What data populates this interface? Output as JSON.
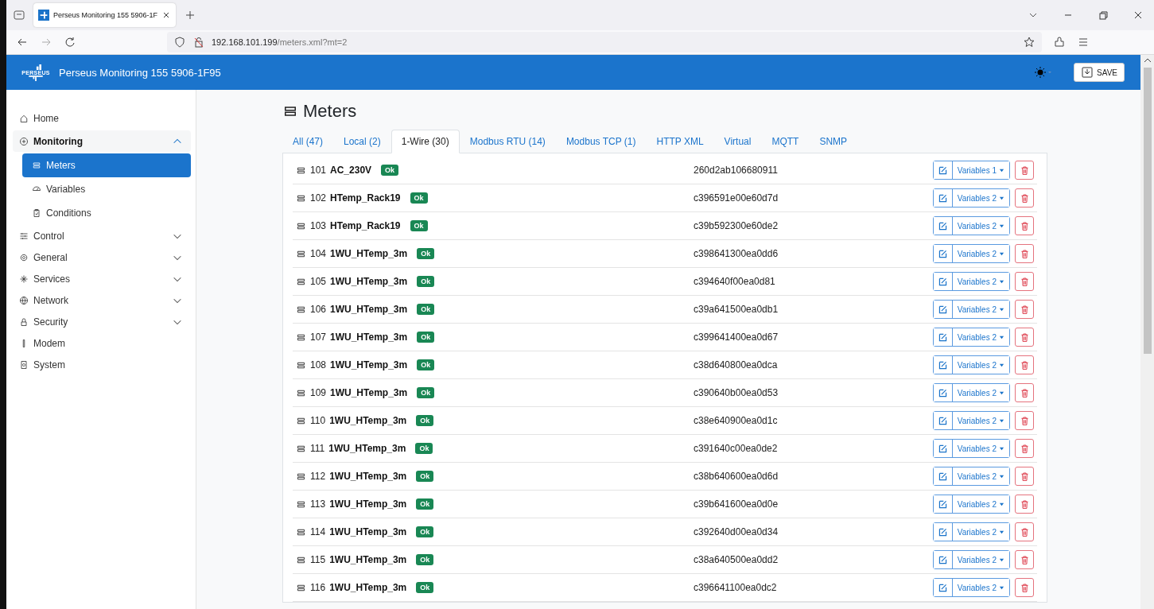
{
  "browser": {
    "tab_title": "Perseus Monitoring 155 5906-1F",
    "url_host": "192.168.101.199",
    "url_path": "/meters.xml?mt=2"
  },
  "header": {
    "logo_text": "PERSEUS",
    "title": "Perseus Monitoring 155 5906-1F95",
    "save_label": "SAVE"
  },
  "sidebar": {
    "items": [
      {
        "label": "Home",
        "selected": false
      },
      {
        "label": "Monitoring",
        "selected": false,
        "expanded": true,
        "children": [
          {
            "label": "Meters",
            "selected": true
          },
          {
            "label": "Variables",
            "selected": false
          },
          {
            "label": "Conditions",
            "selected": false
          }
        ]
      },
      {
        "label": "Control",
        "selected": false,
        "expanded": false
      },
      {
        "label": "General",
        "selected": false,
        "expanded": false
      },
      {
        "label": "Services",
        "selected": false,
        "expanded": false
      },
      {
        "label": "Network",
        "selected": false,
        "expanded": false
      },
      {
        "label": "Security",
        "selected": false,
        "expanded": false
      },
      {
        "label": "Modem",
        "selected": false
      },
      {
        "label": "System",
        "selected": false
      }
    ]
  },
  "page": {
    "title": "Meters"
  },
  "tabs": [
    {
      "label": "All (47)",
      "selected": false
    },
    {
      "label": "Local (2)",
      "selected": false
    },
    {
      "label": "1-Wire (30)",
      "selected": true
    },
    {
      "label": "Modbus RTU (14)",
      "selected": false
    },
    {
      "label": "Modbus TCP (1)",
      "selected": false
    },
    {
      "label": "HTTP XML",
      "selected": false
    },
    {
      "label": "Virtual",
      "selected": false
    },
    {
      "label": "MQTT",
      "selected": false
    },
    {
      "label": "SNMP",
      "selected": false
    }
  ],
  "meters": [
    {
      "number": "101",
      "name": "AC_230V",
      "status": "Ok",
      "address": "260d2ab106680911",
      "variables": "Variables 1"
    },
    {
      "number": "102",
      "name": "HTemp_Rack19",
      "status": "Ok",
      "address": "c396591e00e60d7d",
      "variables": "Variables 2"
    },
    {
      "number": "103",
      "name": "HTemp_Rack19",
      "status": "Ok",
      "address": "c39b592300e60de2",
      "variables": "Variables 2"
    },
    {
      "number": "104",
      "name": "1WU_HTemp_3m",
      "status": "Ok",
      "address": "c398641300ea0dd6",
      "variables": "Variables 2"
    },
    {
      "number": "105",
      "name": "1WU_HTemp_3m",
      "status": "Ok",
      "address": "c394640f00ea0d81",
      "variables": "Variables 2"
    },
    {
      "number": "106",
      "name": "1WU_HTemp_3m",
      "status": "Ok",
      "address": "c39a641500ea0db1",
      "variables": "Variables 2"
    },
    {
      "number": "107",
      "name": "1WU_HTemp_3m",
      "status": "Ok",
      "address": "c399641400ea0d67",
      "variables": "Variables 2"
    },
    {
      "number": "108",
      "name": "1WU_HTemp_3m",
      "status": "Ok",
      "address": "c38d640800ea0dca",
      "variables": "Variables 2"
    },
    {
      "number": "109",
      "name": "1WU_HTemp_3m",
      "status": "Ok",
      "address": "c390640b00ea0d53",
      "variables": "Variables 2"
    },
    {
      "number": "110",
      "name": "1WU_HTemp_3m",
      "status": "Ok",
      "address": "c38e640900ea0d1c",
      "variables": "Variables 2"
    },
    {
      "number": "111",
      "name": "1WU_HTemp_3m",
      "status": "Ok",
      "address": "c391640c00ea0de2",
      "variables": "Variables 2"
    },
    {
      "number": "112",
      "name": "1WU_HTemp_3m",
      "status": "Ok",
      "address": "c38b640600ea0d6d",
      "variables": "Variables 2"
    },
    {
      "number": "113",
      "name": "1WU_HTemp_3m",
      "status": "Ok",
      "address": "c39b641600ea0d0e",
      "variables": "Variables 2"
    },
    {
      "number": "114",
      "name": "1WU_HTemp_3m",
      "status": "Ok",
      "address": "c392640d00ea0d34",
      "variables": "Variables 2"
    },
    {
      "number": "115",
      "name": "1WU_HTemp_3m",
      "status": "Ok",
      "address": "c38a640500ea0dd2",
      "variables": "Variables 2"
    },
    {
      "number": "116",
      "name": "1WU_HTemp_3m",
      "status": "Ok",
      "address": "c396641100ea0dc2",
      "variables": "Variables 2"
    }
  ]
}
